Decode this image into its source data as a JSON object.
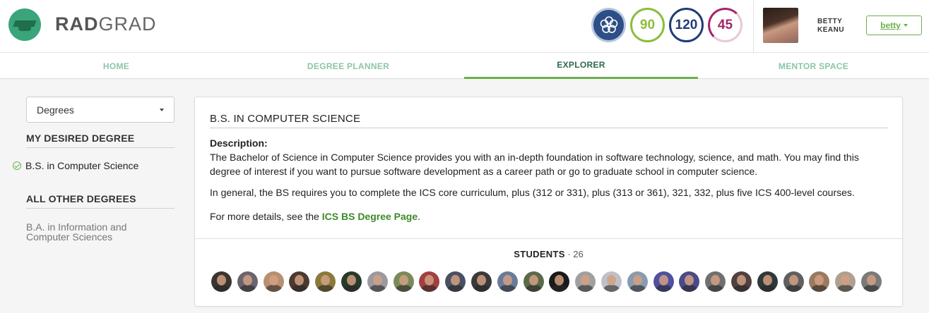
{
  "header": {
    "brand_bold": "RAD",
    "brand_light": "GRAD",
    "badges": {
      "innovation": "90",
      "competency": "120",
      "experience": "45"
    },
    "user_first": "BETTY",
    "user_last": "KEANU",
    "user_button": "betty"
  },
  "nav": {
    "home": "HOME",
    "degree_planner": "DEGREE PLANNER",
    "explorer": "EXPLORER",
    "mentor_space": "MENTOR SPACE",
    "active": "EXPLORER"
  },
  "sidebar": {
    "dropdown_value": "Degrees",
    "my_desired_heading": "MY DESIRED DEGREE",
    "desired_item": "B.S. in Computer Science",
    "other_heading": "ALL OTHER DEGREES",
    "other_item": "B.A. in Information and Computer Sciences"
  },
  "main": {
    "title": "B.S. IN COMPUTER SCIENCE",
    "description_label": "Description:",
    "description": "The Bachelor of Science in Computer Science provides you with an in-depth foundation in software technology, science, and math. You may find this degree of interest if you want to pursue software development as a career path or go to graduate school in computer science.",
    "requirements": "In general, the BS requires you to complete the ICS core curriculum, plus (312 or 331), plus (313 or 361), 321, 332, plus five ICS 400-level courses.",
    "details_prefix": "For more details, see the ",
    "details_link": "ICS BS Degree Page",
    "details_suffix": ".",
    "students_label": "STUDENTS",
    "students_sep": " · ",
    "students_count": "26"
  },
  "colors": {
    "accent_green": "#6ab04c",
    "nav_inactive": "#8cc5a8",
    "nav_active": "#2e6a4a",
    "innovation": "#8cbd3d",
    "competency": "#1f3c78",
    "experience": "#a5256b",
    "link": "#3c8a2a"
  },
  "student_avatar_colors": [
    "#3a3530",
    "#6a6470",
    "#b89070",
    "#4a3a30",
    "#8a7a3a",
    "#2a3a2a",
    "#9a9aa0",
    "#7a8a5a",
    "#a04040",
    "#4a5060",
    "#3a3a3a",
    "#6a7a9a",
    "#5a6a4a",
    "#1a1a1a",
    "#a0a0a0",
    "#c0c0c8",
    "#8a9ab0",
    "#5050a0",
    "#4a4a8a",
    "#707070",
    "#504040",
    "#303838",
    "#606060",
    "#9a7a60",
    "#b0a090",
    "#7a7a7a"
  ]
}
